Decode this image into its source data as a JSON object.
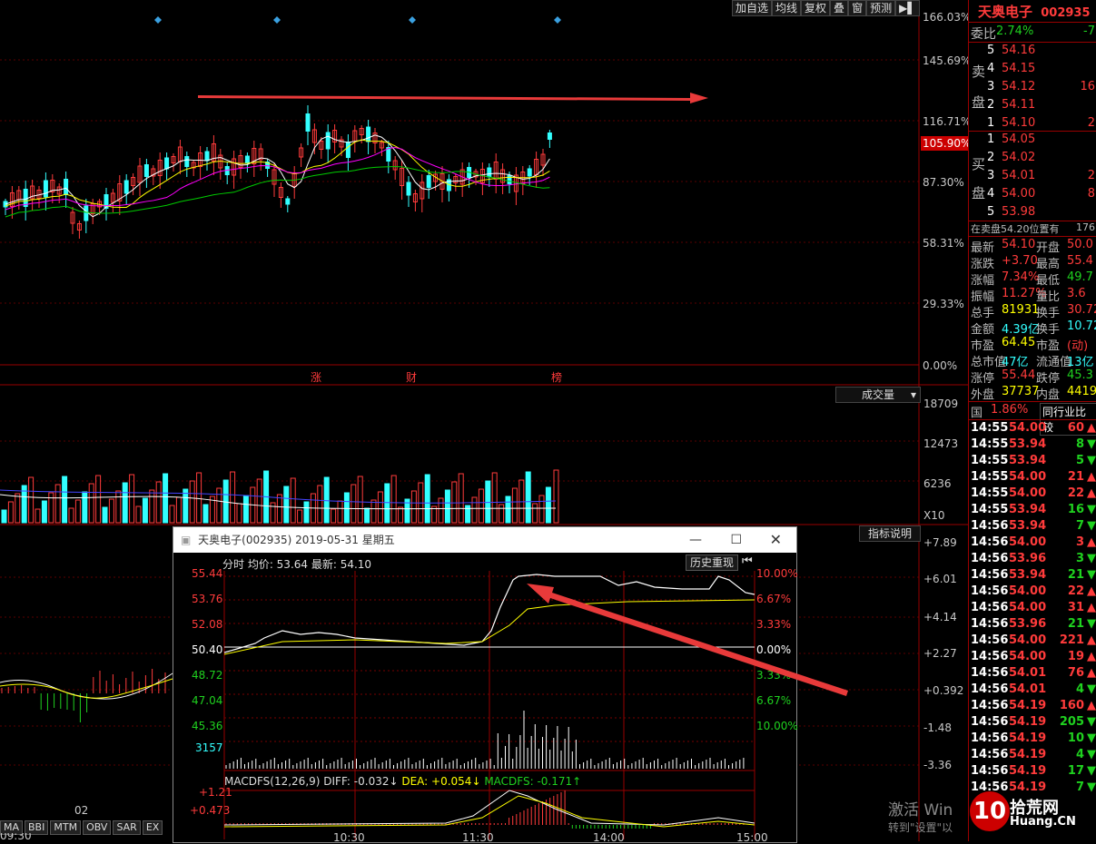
{
  "toolbar": {
    "buttons": [
      "加自选",
      "均线",
      "复权",
      "叠",
      "窗",
      "预测",
      "▶▌"
    ]
  },
  "stock": {
    "name": "天奥电子",
    "code": "002935"
  },
  "main_chart": {
    "y_ticks": [
      "166.03%",
      "145.69%",
      "116.71%",
      "87.30%",
      "58.31%",
      "29.33%",
      "0.00%"
    ],
    "current_badge": "105.90%",
    "event_markers": [
      "涨",
      "财",
      "榜"
    ]
  },
  "volume": {
    "label": "成交量",
    "y_ticks": [
      "18709",
      "12473",
      "6236"
    ],
    "unit": "X10"
  },
  "macd_panel": {
    "label": "指标说明",
    "y_ticks": [
      "+7.89",
      "+6.01",
      "+4.14",
      "+2.27",
      "+0.392",
      "-1.48",
      "-3.36"
    ]
  },
  "bottom_tabs": [
    "MA",
    "BBI",
    "MTM",
    "OBV",
    "SAR",
    "EX"
  ],
  "bottom_date": "02",
  "bottom_time_left": "09:30",
  "order_book": {
    "weibi_label": "委比",
    "weibi_value": "2.74%",
    "weibi_right": "-7",
    "sell_label_1": "卖",
    "sell_label_2": "盘",
    "buy_label_1": "买",
    "buy_label_2": "盘",
    "sell": [
      {
        "level": "5",
        "price": "54.16",
        "vol": ""
      },
      {
        "level": "4",
        "price": "54.15",
        "vol": ""
      },
      {
        "level": "3",
        "price": "54.12",
        "vol": "16"
      },
      {
        "level": "2",
        "price": "54.11",
        "vol": ""
      },
      {
        "level": "1",
        "price": "54.10",
        "vol": "2"
      }
    ],
    "buy": [
      {
        "level": "1",
        "price": "54.05",
        "vol": ""
      },
      {
        "level": "2",
        "price": "54.02",
        "vol": ""
      },
      {
        "level": "3",
        "price": "54.01",
        "vol": "2"
      },
      {
        "level": "4",
        "price": "54.00",
        "vol": "8"
      },
      {
        "level": "5",
        "price": "53.98",
        "vol": ""
      }
    ],
    "status_line": "在卖盘54.20位置有",
    "status_right": "176"
  },
  "quote": [
    {
      "k1": "最新",
      "v1": "54.10",
      "k2": "开盘",
      "v2": "50.0"
    },
    {
      "k1": "涨跌",
      "v1": "+3.70",
      "k2": "最高",
      "v2": "55.4"
    },
    {
      "k1": "涨幅",
      "v1": "7.34%",
      "k2": "最低",
      "v2": "49.7"
    },
    {
      "k1": "振幅",
      "v1": "11.27%",
      "k2": "量比",
      "v2": "3.6"
    },
    {
      "k1": "总手",
      "v1": "81931",
      "k2": "换手",
      "v2": "30.72"
    },
    {
      "k1": "金额",
      "v1": "4.39亿",
      "k2": "换手",
      "v2": "10.72"
    },
    {
      "k1": "市盈",
      "v1": "64.45",
      "k2": "市盈",
      "v2": "(动)"
    },
    {
      "k1": "总市值",
      "v1": "47亿",
      "k2": "流通值",
      "v2": "13亿"
    },
    {
      "k1": "涨停",
      "v1": "55.44",
      "k2": "跌停",
      "v2": "45.3"
    },
    {
      "k1": "外盘",
      "v1": "37737",
      "k2": "内盘",
      "v2": "4419"
    }
  ],
  "industry_row": {
    "label": "国",
    "value": "1.86%",
    "button": "同行业比较"
  },
  "ticks": [
    {
      "t": "14:55",
      "p": "54.00",
      "v": "60",
      "d": "up"
    },
    {
      "t": "14:55",
      "p": "53.94",
      "v": "8",
      "d": "down"
    },
    {
      "t": "14:55",
      "p": "53.94",
      "v": "5",
      "d": "down"
    },
    {
      "t": "14:55",
      "p": "54.00",
      "v": "21",
      "d": "up"
    },
    {
      "t": "14:55",
      "p": "54.00",
      "v": "22",
      "d": "up"
    },
    {
      "t": "14:55",
      "p": "53.94",
      "v": "16",
      "d": "down"
    },
    {
      "t": "14:56",
      "p": "53.94",
      "v": "7",
      "d": "down"
    },
    {
      "t": "14:56",
      "p": "54.00",
      "v": "3",
      "d": "up"
    },
    {
      "t": "14:56",
      "p": "53.96",
      "v": "3",
      "d": "down"
    },
    {
      "t": "14:56",
      "p": "53.94",
      "v": "21",
      "d": "down"
    },
    {
      "t": "14:56",
      "p": "54.00",
      "v": "22",
      "d": "up"
    },
    {
      "t": "14:56",
      "p": "54.00",
      "v": "31",
      "d": "up"
    },
    {
      "t": "14:56",
      "p": "53.96",
      "v": "21",
      "d": "down"
    },
    {
      "t": "14:56",
      "p": "54.00",
      "v": "221",
      "d": "up"
    },
    {
      "t": "14:56",
      "p": "54.00",
      "v": "19",
      "d": "up"
    },
    {
      "t": "14:56",
      "p": "54.01",
      "v": "76",
      "d": "up"
    },
    {
      "t": "14:56",
      "p": "54.01",
      "v": "4",
      "d": "down"
    },
    {
      "t": "14:56",
      "p": "54.19",
      "v": "160",
      "d": "up"
    },
    {
      "t": "14:56",
      "p": "54.19",
      "v": "205",
      "d": "down"
    },
    {
      "t": "14:56",
      "p": "54.19",
      "v": "10",
      "d": "down"
    },
    {
      "t": "14:56",
      "p": "54.19",
      "v": "4",
      "d": "down"
    },
    {
      "t": "14:56",
      "p": "54.19",
      "v": "17",
      "d": "down"
    },
    {
      "t": "14:56",
      "p": "54.19",
      "v": "7",
      "d": "down"
    }
  ],
  "popup": {
    "title": "天奥电子(002935) 2019-05-31 星期五",
    "header": "分时 均价: 53.64 最新: 54.10",
    "button": "历史重现",
    "left_prices": [
      "55.44",
      "53.76",
      "52.08",
      "50.40",
      "48.72",
      "47.04",
      "45.36"
    ],
    "right_pcts": [
      "10.00%",
      "6.67%",
      "3.33%",
      "0.00%",
      "3.33%",
      "6.67%",
      "10.00%"
    ],
    "vol_label": "3157",
    "macd_line": {
      "name": "MACDFS(12,26,9)",
      "diff": "DIFF: -0.032↓",
      "dea": "DEA: +0.054↓",
      "macdfs": "MACDFS: -0.171↑"
    },
    "macd_ticks": [
      "+1.21",
      "+0.473"
    ],
    "times": [
      "10:30",
      "11:30",
      "14:00",
      "15:00"
    ]
  },
  "watermark": {
    "line1": "激活 Win",
    "line2": "转到\"设置\"以",
    "logo": "10",
    "logo_text": "拾荒网",
    "logo_url": "Huang.CN"
  },
  "colors": {
    "up": "#ff3b3b",
    "down": "#3ff",
    "panel_red": "#900"
  }
}
